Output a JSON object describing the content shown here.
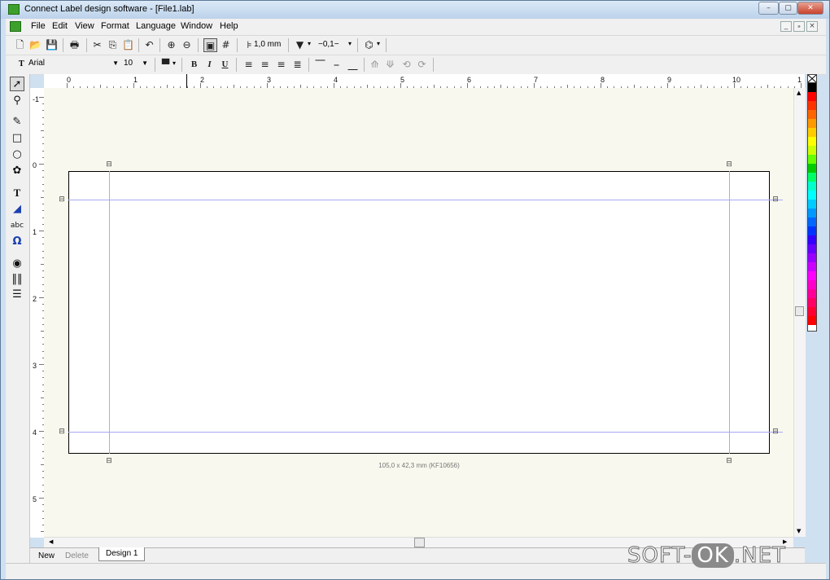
{
  "window": {
    "title": "Connect Label design software - [File1.lab]",
    "buttons": [
      "–",
      "▢",
      "✕"
    ]
  },
  "menu": {
    "items": [
      "File",
      "Edit",
      "View",
      "Format",
      "Language",
      "Window",
      "Help"
    ],
    "mdi_buttons": [
      "_",
      "ₔ",
      "×"
    ]
  },
  "toolbar1": {
    "line_width": "1,0 mm",
    "line_style": "0,1"
  },
  "toolbar2": {
    "font_name": "Arial",
    "font_size": "10",
    "bold": "B",
    "italic": "I",
    "underline": "U"
  },
  "rulers": {
    "horizontal": [
      "0",
      "1",
      "2",
      "3",
      "4",
      "5",
      "6",
      "7",
      "8",
      "9",
      "10",
      "1"
    ],
    "vertical": [
      "-1",
      "0",
      "1",
      "2",
      "3",
      "4",
      "5"
    ]
  },
  "label": {
    "dimensions": "105,0 x 42,3 mm (KF10656)"
  },
  "tabs": {
    "new": "New",
    "delete": "Delete",
    "design": "Design 1"
  },
  "palette": {
    "colors": [
      "#000000",
      "#ff0000",
      "#ff3300",
      "#ff6600",
      "#ff9900",
      "#ffcc00",
      "#ffff00",
      "#ccff00",
      "#66ff00",
      "#00cc00",
      "#00ff66",
      "#00ffcc",
      "#00ffff",
      "#00ccff",
      "#0099ff",
      "#0066ff",
      "#0033ff",
      "#3300ff",
      "#6600ff",
      "#9900ff",
      "#cc00ff",
      "#ff00ff",
      "#ff00cc",
      "#ff0099",
      "#ff0066",
      "#ff0033",
      "#ff0000"
    ]
  },
  "watermark": {
    "left": "SOFT-",
    "ok": "OK",
    "right": ".NET"
  }
}
